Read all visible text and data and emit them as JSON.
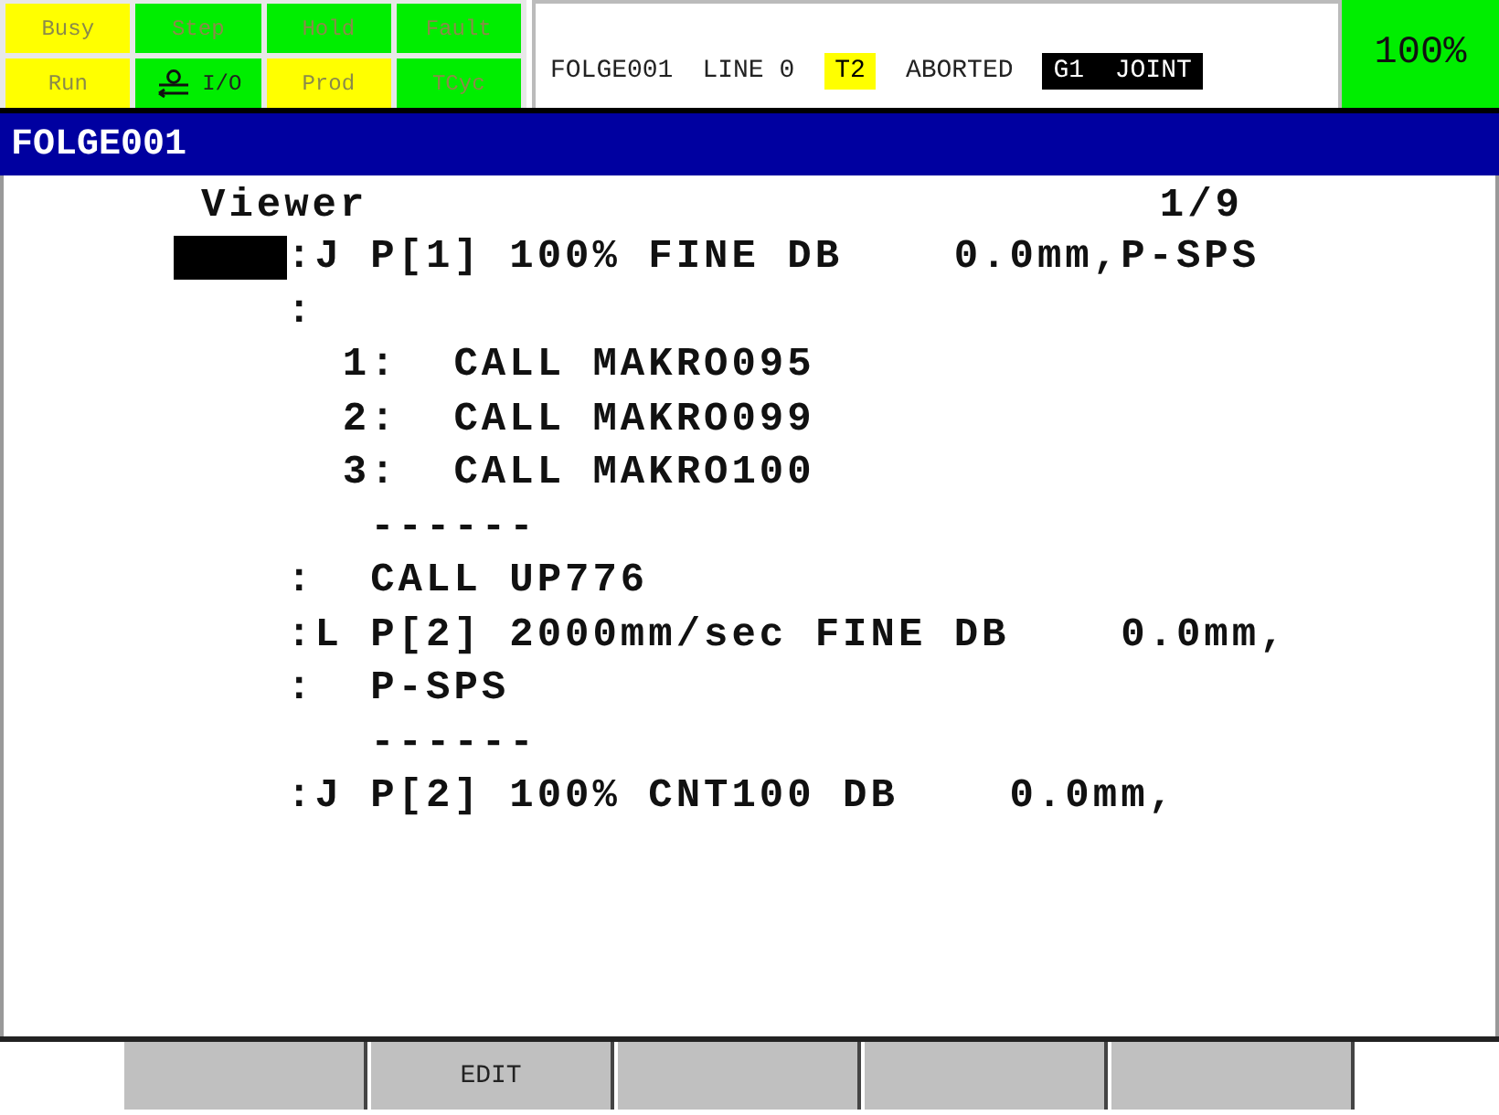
{
  "status_lamps": [
    {
      "label": "Busy",
      "color": "#ffff00",
      "dim": true,
      "kind": "text"
    },
    {
      "label": "Step",
      "color": "#00ee00",
      "dim": true,
      "kind": "text"
    },
    {
      "label": "Hold",
      "color": "#00ee00",
      "dim": true,
      "kind": "text"
    },
    {
      "label": "Fault",
      "color": "#00ee00",
      "dim": true,
      "kind": "text"
    },
    {
      "label": "Run",
      "color": "#ffff00",
      "dim": true,
      "kind": "text"
    },
    {
      "label": "I/O",
      "color": "#00ee00",
      "dim": false,
      "kind": "io"
    },
    {
      "label": "Prod",
      "color": "#ffff00",
      "dim": true,
      "kind": "text"
    },
    {
      "label": "TCyc",
      "color": "#00ee00",
      "dim": true,
      "kind": "text"
    }
  ],
  "status_line": [
    {
      "text": "FOLGE001",
      "kind": "plain"
    },
    {
      "text": "LINE 0",
      "kind": "plain"
    },
    {
      "text": "T2",
      "kind": "warning"
    },
    {
      "text": "ABORTED",
      "kind": "plain"
    },
    {
      "text": "G1  JOINT",
      "kind": "inverse"
    }
  ],
  "override": "100%",
  "title": "FOLGE001",
  "viewer": {
    "label": "Viewer",
    "page": "1/9"
  },
  "lines": [
    {
      "text": ":J P[1] 100% FINE DB    0.0mm,P-SPS",
      "cursor": true
    },
    {
      "text": ":",
      "cursor": false
    },
    {
      "text": "  1:  CALL MAKRO095",
      "cursor": false
    },
    {
      "text": "  2:  CALL MAKRO099",
      "cursor": false
    },
    {
      "text": "  3:  CALL MAKRO100",
      "cursor": false
    },
    {
      "text": "   ------",
      "cursor": false
    },
    {
      "text": ":  CALL UP776",
      "cursor": false
    },
    {
      "text": ":L P[2] 2000mm/sec FINE DB    0.0mm,",
      "cursor": false
    },
    {
      "text": ":  P-SPS",
      "cursor": false
    },
    {
      "text": "   ------",
      "cursor": false
    },
    {
      "text": ":J P[2] 100% CNT100 DB    0.0mm,",
      "cursor": false
    }
  ],
  "function_keys": [
    {
      "kind": "blank"
    },
    {
      "kind": "labeled",
      "label": "EDIT"
    },
    {
      "kind": "blank"
    },
    {
      "kind": "blank"
    },
    {
      "kind": "blank"
    }
  ]
}
